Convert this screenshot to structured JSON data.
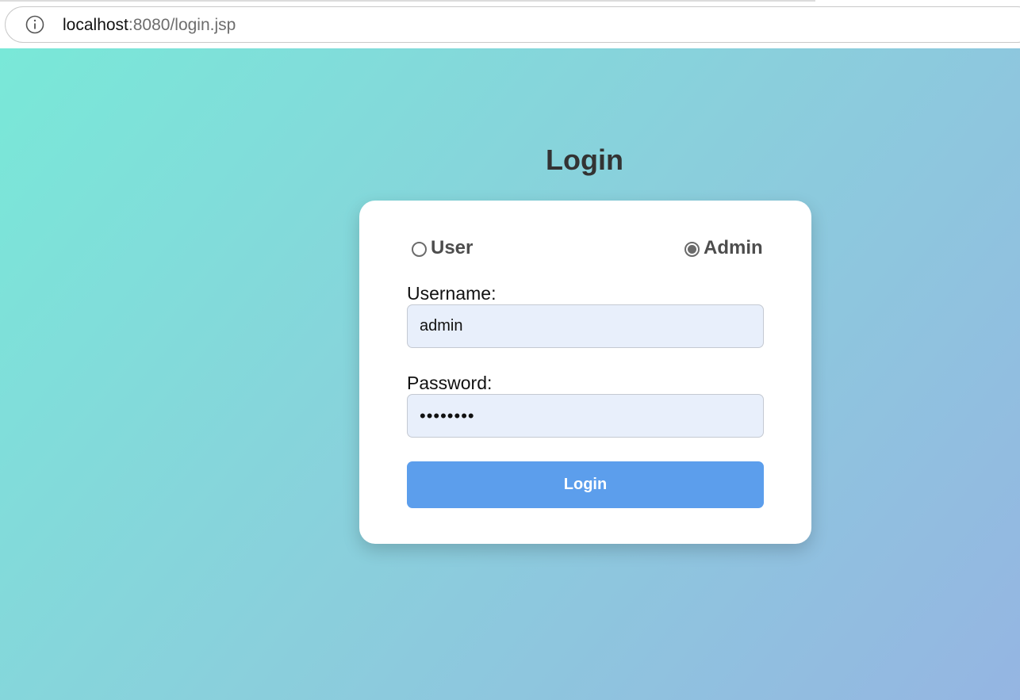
{
  "browser": {
    "url_host": "localhost",
    "url_rest": ":8080/login.jsp"
  },
  "page": {
    "title": "Login"
  },
  "login_form": {
    "roles": [
      {
        "label": "User",
        "checked": false
      },
      {
        "label": "Admin",
        "checked": true
      }
    ],
    "username_label": "Username:",
    "username_value": "admin",
    "password_label": "Password:",
    "password_masked": "••••••••",
    "submit_label": "Login"
  },
  "colors": {
    "background_gradient_start": "#79e8d8",
    "background_gradient_end": "#95b5e2",
    "button": "#5c9eec",
    "input_background": "#e8effb",
    "title_text": "#333333"
  },
  "icons": {
    "address_bar": "info-icon"
  }
}
